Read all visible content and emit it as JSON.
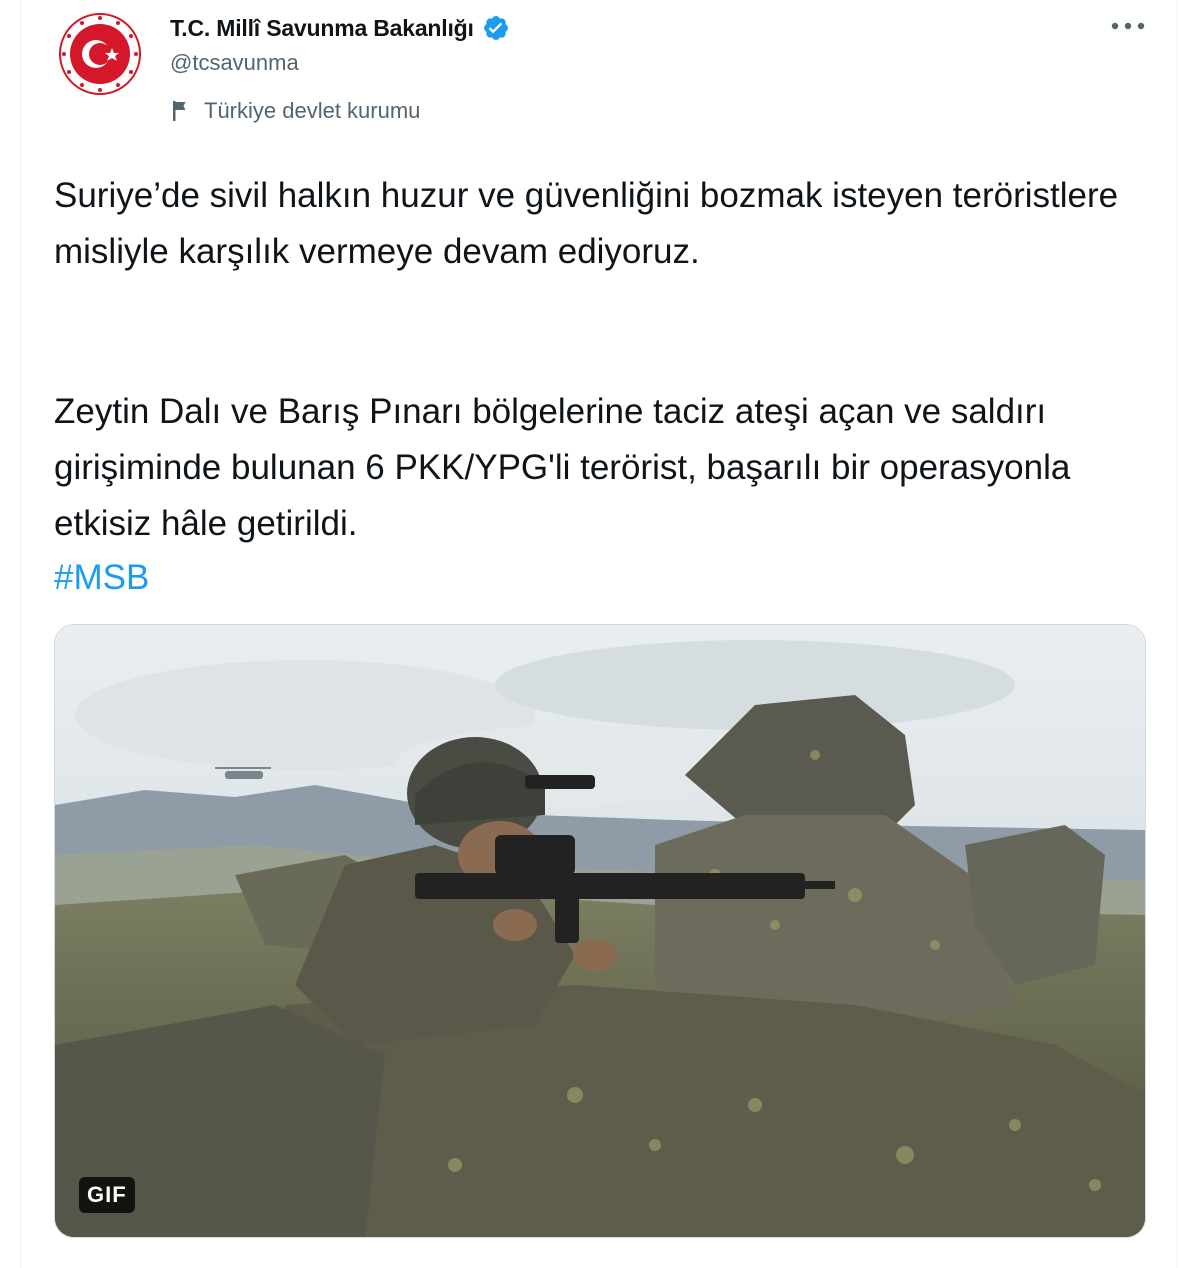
{
  "tweet": {
    "author": {
      "display_name": "T.C. Millî Savunma Bakanlığı",
      "handle": "@tcsavunma",
      "account_label": "Türkiye devlet kurumu",
      "avatar_icon": "msb-emblem-icon",
      "verified_icon": "verified-badge-icon",
      "label_icon": "flag-icon"
    },
    "more_icon": "more-options-icon",
    "text_paragraph_1": "Suriye’de sivil halkın huzur ve güvenliğini bozmak isteyen teröristlere misliyle karşılık vermeye devam ediyoruz.",
    "text_paragraph_2": "Zeytin Dalı ve Barış Pınarı bölgelerine taciz ateşi açan ve saldırı girişiminde bulunan 6 PKK/YPG'li terörist, başarılı bir operasyonla etkisiz hâle getirildi.",
    "hashtag": "#MSB",
    "media": {
      "type": "gif",
      "badge": "GIF"
    }
  },
  "colors": {
    "text": "#0f1419",
    "secondary": "#536471",
    "link": "#1d9bf0",
    "verified": "#1d9bf0",
    "emblem_red": "#d4182a"
  }
}
